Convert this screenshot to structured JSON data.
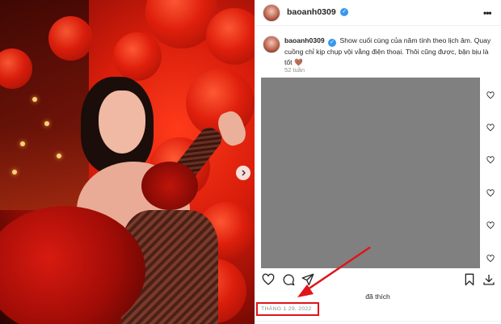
{
  "post": {
    "username": "baoanh0309",
    "verified": true,
    "caption_text": "Show cuối cùng của năm tính theo lịch âm. Quay cuồng chỉ kịp chụp vội vằng điện thoại. Thôi cũng được, bận bịu là tốt 🤎",
    "post_age": "52 tuần",
    "likes_text": "đã thích",
    "date": "THÁNG 1 29, 2022"
  },
  "icons": {
    "more": "more-options-icon",
    "verified": "verified-badge-icon",
    "like": "heart-icon",
    "comment": "comment-icon",
    "share": "paper-plane-icon",
    "save": "bookmark-icon",
    "download": "download-icon",
    "next": "chevron-right-icon"
  },
  "colors": {
    "annotation_red": "#e0141a",
    "verified_blue": "#3897f0",
    "text_secondary": "#8e8e8e"
  }
}
